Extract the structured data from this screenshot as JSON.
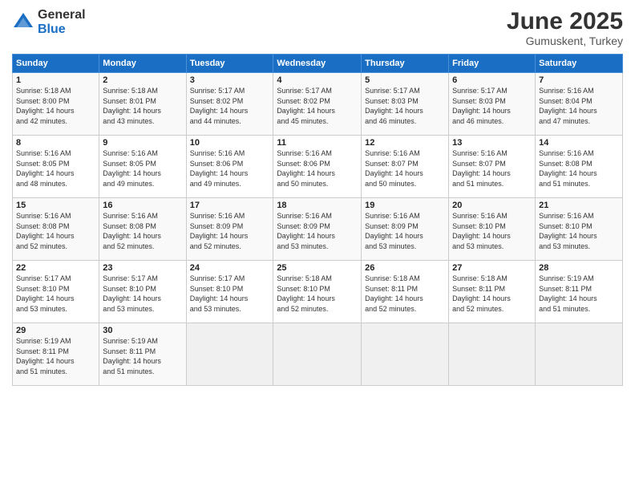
{
  "header": {
    "logo_general": "General",
    "logo_blue": "Blue",
    "month": "June 2025",
    "location": "Gumuskent, Turkey"
  },
  "weekdays": [
    "Sunday",
    "Monday",
    "Tuesday",
    "Wednesday",
    "Thursday",
    "Friday",
    "Saturday"
  ],
  "weeks": [
    [
      {
        "day": "1",
        "info": "Sunrise: 5:18 AM\nSunset: 8:00 PM\nDaylight: 14 hours\nand 42 minutes."
      },
      {
        "day": "2",
        "info": "Sunrise: 5:18 AM\nSunset: 8:01 PM\nDaylight: 14 hours\nand 43 minutes."
      },
      {
        "day": "3",
        "info": "Sunrise: 5:17 AM\nSunset: 8:02 PM\nDaylight: 14 hours\nand 44 minutes."
      },
      {
        "day": "4",
        "info": "Sunrise: 5:17 AM\nSunset: 8:02 PM\nDaylight: 14 hours\nand 45 minutes."
      },
      {
        "day": "5",
        "info": "Sunrise: 5:17 AM\nSunset: 8:03 PM\nDaylight: 14 hours\nand 46 minutes."
      },
      {
        "day": "6",
        "info": "Sunrise: 5:17 AM\nSunset: 8:03 PM\nDaylight: 14 hours\nand 46 minutes."
      },
      {
        "day": "7",
        "info": "Sunrise: 5:16 AM\nSunset: 8:04 PM\nDaylight: 14 hours\nand 47 minutes."
      }
    ],
    [
      {
        "day": "8",
        "info": "Sunrise: 5:16 AM\nSunset: 8:05 PM\nDaylight: 14 hours\nand 48 minutes."
      },
      {
        "day": "9",
        "info": "Sunrise: 5:16 AM\nSunset: 8:05 PM\nDaylight: 14 hours\nand 49 minutes."
      },
      {
        "day": "10",
        "info": "Sunrise: 5:16 AM\nSunset: 8:06 PM\nDaylight: 14 hours\nand 49 minutes."
      },
      {
        "day": "11",
        "info": "Sunrise: 5:16 AM\nSunset: 8:06 PM\nDaylight: 14 hours\nand 50 minutes."
      },
      {
        "day": "12",
        "info": "Sunrise: 5:16 AM\nSunset: 8:07 PM\nDaylight: 14 hours\nand 50 minutes."
      },
      {
        "day": "13",
        "info": "Sunrise: 5:16 AM\nSunset: 8:07 PM\nDaylight: 14 hours\nand 51 minutes."
      },
      {
        "day": "14",
        "info": "Sunrise: 5:16 AM\nSunset: 8:08 PM\nDaylight: 14 hours\nand 51 minutes."
      }
    ],
    [
      {
        "day": "15",
        "info": "Sunrise: 5:16 AM\nSunset: 8:08 PM\nDaylight: 14 hours\nand 52 minutes."
      },
      {
        "day": "16",
        "info": "Sunrise: 5:16 AM\nSunset: 8:08 PM\nDaylight: 14 hours\nand 52 minutes."
      },
      {
        "day": "17",
        "info": "Sunrise: 5:16 AM\nSunset: 8:09 PM\nDaylight: 14 hours\nand 52 minutes."
      },
      {
        "day": "18",
        "info": "Sunrise: 5:16 AM\nSunset: 8:09 PM\nDaylight: 14 hours\nand 53 minutes."
      },
      {
        "day": "19",
        "info": "Sunrise: 5:16 AM\nSunset: 8:09 PM\nDaylight: 14 hours\nand 53 minutes."
      },
      {
        "day": "20",
        "info": "Sunrise: 5:16 AM\nSunset: 8:10 PM\nDaylight: 14 hours\nand 53 minutes."
      },
      {
        "day": "21",
        "info": "Sunrise: 5:16 AM\nSunset: 8:10 PM\nDaylight: 14 hours\nand 53 minutes."
      }
    ],
    [
      {
        "day": "22",
        "info": "Sunrise: 5:17 AM\nSunset: 8:10 PM\nDaylight: 14 hours\nand 53 minutes."
      },
      {
        "day": "23",
        "info": "Sunrise: 5:17 AM\nSunset: 8:10 PM\nDaylight: 14 hours\nand 53 minutes."
      },
      {
        "day": "24",
        "info": "Sunrise: 5:17 AM\nSunset: 8:10 PM\nDaylight: 14 hours\nand 53 minutes."
      },
      {
        "day": "25",
        "info": "Sunrise: 5:18 AM\nSunset: 8:10 PM\nDaylight: 14 hours\nand 52 minutes."
      },
      {
        "day": "26",
        "info": "Sunrise: 5:18 AM\nSunset: 8:11 PM\nDaylight: 14 hours\nand 52 minutes."
      },
      {
        "day": "27",
        "info": "Sunrise: 5:18 AM\nSunset: 8:11 PM\nDaylight: 14 hours\nand 52 minutes."
      },
      {
        "day": "28",
        "info": "Sunrise: 5:19 AM\nSunset: 8:11 PM\nDaylight: 14 hours\nand 51 minutes."
      }
    ],
    [
      {
        "day": "29",
        "info": "Sunrise: 5:19 AM\nSunset: 8:11 PM\nDaylight: 14 hours\nand 51 minutes."
      },
      {
        "day": "30",
        "info": "Sunrise: 5:19 AM\nSunset: 8:11 PM\nDaylight: 14 hours\nand 51 minutes."
      },
      {
        "day": "",
        "info": ""
      },
      {
        "day": "",
        "info": ""
      },
      {
        "day": "",
        "info": ""
      },
      {
        "day": "",
        "info": ""
      },
      {
        "day": "",
        "info": ""
      }
    ]
  ]
}
